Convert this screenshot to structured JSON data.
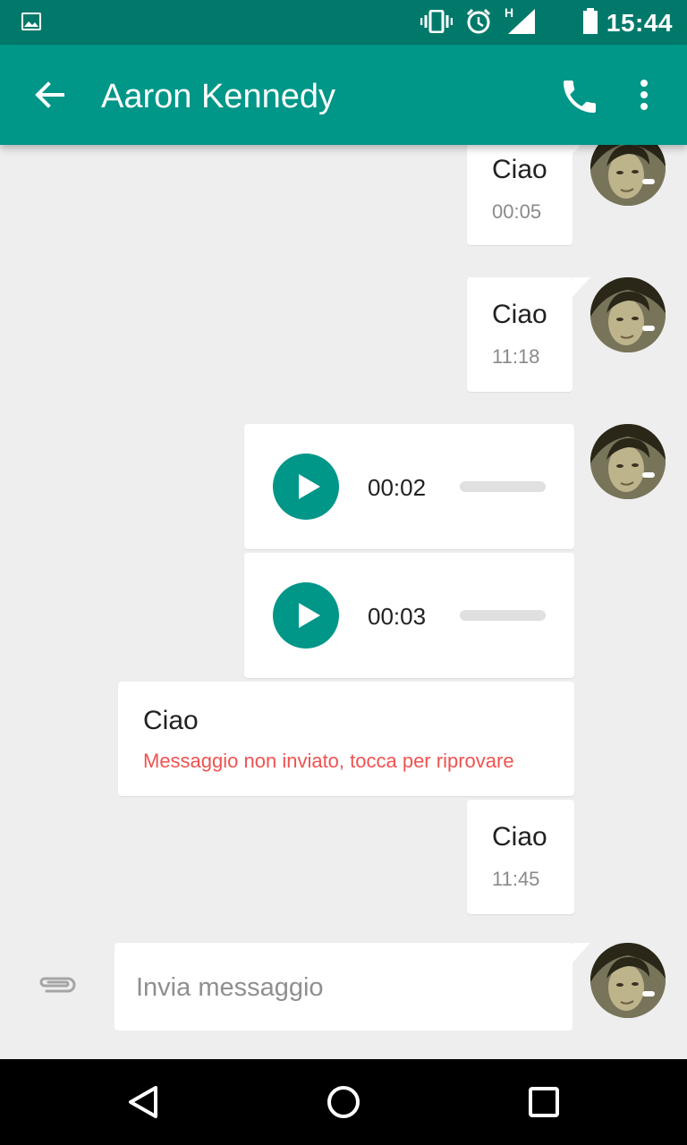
{
  "status_bar": {
    "time": "15:44",
    "network_type": "H",
    "icons": [
      "image-icon",
      "vibrate-icon",
      "alarm-icon",
      "signal-icon",
      "battery-icon"
    ]
  },
  "app_bar": {
    "title": "Aaron Kennedy",
    "icons": [
      "back-arrow-icon",
      "phone-icon",
      "more-vert-icon"
    ]
  },
  "messages": [
    {
      "type": "text",
      "text": "Ciao",
      "time": "00:05"
    },
    {
      "type": "text",
      "text": "Ciao",
      "time": "11:18"
    },
    {
      "type": "voice",
      "duration": "00:02",
      "progress": 0
    },
    {
      "type": "voice",
      "duration": "00:03",
      "progress": 0
    },
    {
      "type": "text",
      "text": "Ciao",
      "error": "Messaggio non inviato, tocca per riprovare"
    },
    {
      "type": "text",
      "text": "Ciao",
      "time": "11:45"
    }
  ],
  "composer": {
    "placeholder": "Invia messaggio",
    "value": ""
  },
  "colors": {
    "status_bar": "#00796b",
    "app_bar": "#009688",
    "accent": "#009688",
    "error": "#ef5350",
    "background": "#eeeeee"
  }
}
